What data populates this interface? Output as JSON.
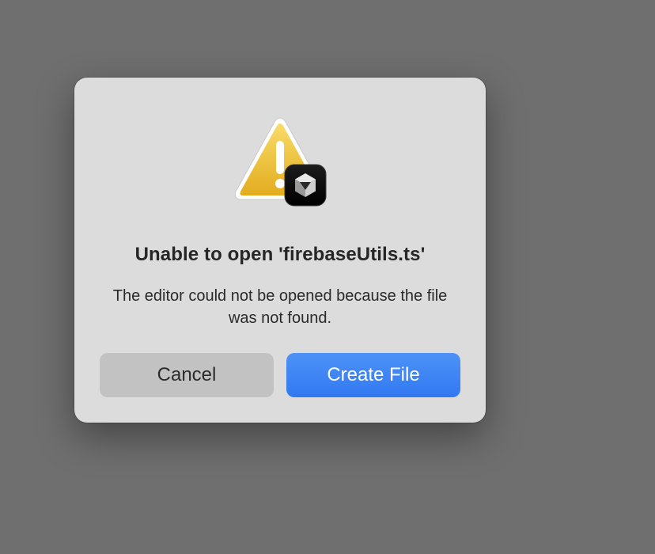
{
  "dialog": {
    "title": "Unable to open 'firebaseUtils.ts'",
    "message": "The editor could not be opened because the file was not found.",
    "icon": "warning-triangle-with-app-badge",
    "cancel_label": "Cancel",
    "primary_label": "Create File"
  },
  "colors": {
    "backdrop": "#6f6f6f",
    "dialog_bg": "#dcdcdc",
    "primary_button": "#3b82f6",
    "cancel_button": "#c2c2c2",
    "warning_yellow": "#f1c232"
  }
}
